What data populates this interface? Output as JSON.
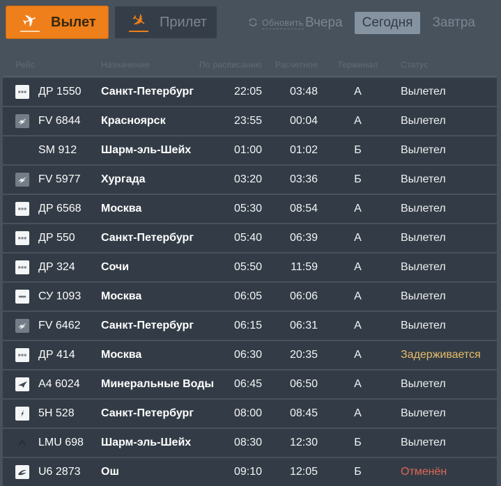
{
  "tabs": {
    "departure": {
      "label": "Вылет",
      "icon": "departure-plane-icon",
      "active": true
    },
    "arrival": {
      "label": "Прилет",
      "icon": "arrival-plane-icon",
      "active": false
    }
  },
  "icons": {
    "plane_glyph": "✈",
    "refresh": "refresh-icon"
  },
  "refresh": {
    "label": "Обновить"
  },
  "day_switcher": {
    "yesterday": "Вчера",
    "today": "Сегодня",
    "tomorrow": "Завтра",
    "selected_day": "Сегодня"
  },
  "table": {
    "columns": {
      "flight": "Рейс",
      "destination": "Назначение",
      "scheduled": "По расписанию",
      "estimated": "Расчетное",
      "terminal": "Терминал",
      "status": "Статус"
    },
    "rows": [
      {
        "icon": "dots-logo-icon",
        "flight": "ДР 1550",
        "destination": "Санкт-Петербург",
        "scheduled": "22:05",
        "estimated": "03:48",
        "terminal": "А",
        "status": "Вылетел",
        "status_type": "departed"
      },
      {
        "icon": "rossiya-wing-icon",
        "flight": "FV 6844",
        "destination": "Красноярск",
        "scheduled": "23:55",
        "estimated": "00:04",
        "terminal": "А",
        "status": "Вылетел",
        "status_type": "departed"
      },
      {
        "icon": "none",
        "flight": "SM 912",
        "destination": "Шарм-эль-Шейх",
        "scheduled": "01:00",
        "estimated": "01:02",
        "terminal": "Б",
        "status": "Вылетел",
        "status_type": "departed"
      },
      {
        "icon": "rossiya-wing-icon",
        "flight": "FV 5977",
        "destination": "Хургада",
        "scheduled": "03:20",
        "estimated": "03:36",
        "terminal": "Б",
        "status": "Вылетел",
        "status_type": "departed"
      },
      {
        "icon": "dots-logo-icon",
        "flight": "ДР 6568",
        "destination": "Москва",
        "scheduled": "05:30",
        "estimated": "08:54",
        "terminal": "А",
        "status": "Вылетел",
        "status_type": "departed"
      },
      {
        "icon": "dots-logo-icon",
        "flight": "ДР 550",
        "destination": "Санкт-Петербург",
        "scheduled": "05:40",
        "estimated": "06:39",
        "terminal": "А",
        "status": "Вылетел",
        "status_type": "departed"
      },
      {
        "icon": "dots-logo-icon",
        "flight": "ДР 324",
        "destination": "Сочи",
        "scheduled": "05:50",
        "estimated": "11:59",
        "terminal": "А",
        "status": "Вылетел",
        "status_type": "departed"
      },
      {
        "icon": "dash-logo-icon",
        "flight": "СУ 1093",
        "destination": "Москва",
        "scheduled": "06:05",
        "estimated": "06:06",
        "terminal": "А",
        "status": "Вылетел",
        "status_type": "departed"
      },
      {
        "icon": "rossiya-wing-icon",
        "flight": "FV 6462",
        "destination": "Санкт-Петербург",
        "scheduled": "06:15",
        "estimated": "06:31",
        "terminal": "А",
        "status": "Вылетел",
        "status_type": "departed"
      },
      {
        "icon": "dots-logo-icon",
        "flight": "ДР 414",
        "destination": "Москва",
        "scheduled": "06:30",
        "estimated": "20:35",
        "terminal": "А",
        "status": "Задерживается",
        "status_type": "delayed"
      },
      {
        "icon": "plane-silhouette-icon",
        "flight": "A4 6024",
        "destination": "Минеральные Воды",
        "scheduled": "06:45",
        "estimated": "06:50",
        "terminal": "А",
        "status": "Вылетел",
        "status_type": "departed"
      },
      {
        "icon": "feather-logo-icon",
        "flight": "5H 528",
        "destination": "Санкт-Петербург",
        "scheduled": "08:00",
        "estimated": "08:45",
        "terminal": "А",
        "status": "Вылетел",
        "status_type": "departed"
      },
      {
        "icon": "chevron-logo-icon",
        "flight": "LMU 698",
        "destination": "Шарм-эль-Шейх",
        "scheduled": "08:30",
        "estimated": "12:30",
        "terminal": "Б",
        "status": "Вылетел",
        "status_type": "departed"
      },
      {
        "icon": "swoosh-logo-icon",
        "flight": "U6 2873",
        "destination": "Ош",
        "scheduled": "09:10",
        "estimated": "12:05",
        "terminal": "Б",
        "status": "Отменён",
        "status_type": "cancelled"
      }
    ]
  },
  "colors": {
    "accent_orange": "#ef7f1a",
    "page_background": "#47525d",
    "row_background": "#333c46",
    "status_delayed": "#e8bd69",
    "status_cancelled": "#dd6757",
    "selected_day_background": "#8593a1"
  }
}
